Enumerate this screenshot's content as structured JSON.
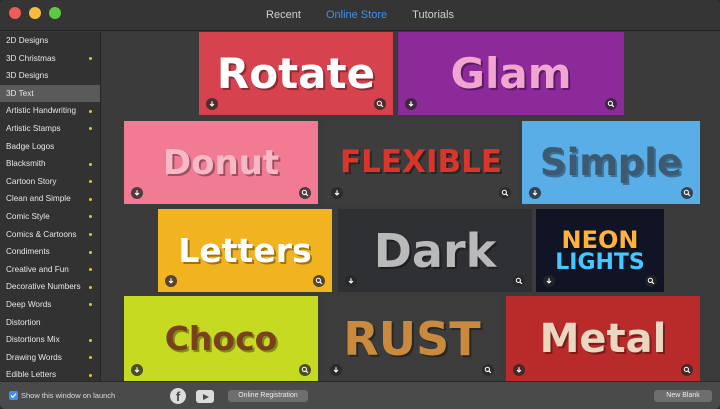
{
  "nav": {
    "tabs": [
      "Recent",
      "Online Store",
      "Tutorials"
    ],
    "active": "Online Store",
    "active_color": "#3f8ef0"
  },
  "sidebar": {
    "items": [
      {
        "label": "2D Designs",
        "dot": false
      },
      {
        "label": "3D Christmas",
        "dot": true
      },
      {
        "label": "3D Designs",
        "dot": false
      },
      {
        "label": "3D Text",
        "dot": false,
        "selected": true
      },
      {
        "label": "Artistic Handwriting",
        "dot": true
      },
      {
        "label": "Artistic Stamps",
        "dot": true
      },
      {
        "label": "Badge Logos",
        "dot": false
      },
      {
        "label": "Blacksmith",
        "dot": true
      },
      {
        "label": "Cartoon Story",
        "dot": true
      },
      {
        "label": "Clean and Simple",
        "dot": true
      },
      {
        "label": "Comic Style",
        "dot": true
      },
      {
        "label": "Comics & Cartoons",
        "dot": true
      },
      {
        "label": "Condiments",
        "dot": true
      },
      {
        "label": "Creative and Fun",
        "dot": true
      },
      {
        "label": "Decorative Numbers",
        "dot": true
      },
      {
        "label": "Deep Words",
        "dot": true
      },
      {
        "label": "Distortion",
        "dot": false
      },
      {
        "label": "Distortions Mix",
        "dot": true
      },
      {
        "label": "Drawing Words",
        "dot": true
      },
      {
        "label": "Edible Letters",
        "dot": true
      }
    ],
    "dot_color": "#e6c230"
  },
  "gallery": [
    {
      "title": "Rotate",
      "bg": "#d6434f",
      "color": "#ffffff"
    },
    {
      "title": "Glam",
      "bg": "#8d2a9a",
      "color": "#f0a6d0"
    },
    {
      "title": "Donut",
      "bg": "#f27b94",
      "color": "#f6b9c5"
    },
    {
      "title": "FLEXIBLE",
      "bg": "#3d3d3d",
      "color": "#d9352a"
    },
    {
      "title": "Simple",
      "bg": "#5aaee8",
      "color": "#3d5a70"
    },
    {
      "title": "Letters",
      "bg": "#f2b320",
      "color": "#ffffff"
    },
    {
      "title": "Dark",
      "bg": "#2f3033",
      "color": "#b9b9b9"
    },
    {
      "title": "NEON",
      "subtitle": "LIGHTS",
      "bg": "#101424",
      "color": "#ffb33a",
      "subcolor": "#44c8ff"
    },
    {
      "title": "Choco",
      "bg": "#c6da22",
      "color": "#7a3f1c"
    },
    {
      "title": "RUST",
      "bg": "#3c3c3c",
      "color": "#c98a3e"
    },
    {
      "title": "Metal",
      "bg": "#b92a2a",
      "color": "#ead7c0"
    }
  ],
  "footer": {
    "show_on_launch_label": "Show this window on launch",
    "show_on_launch_checked": true,
    "registration_label": "Online Registration",
    "new_blank_label": "New Blank"
  }
}
